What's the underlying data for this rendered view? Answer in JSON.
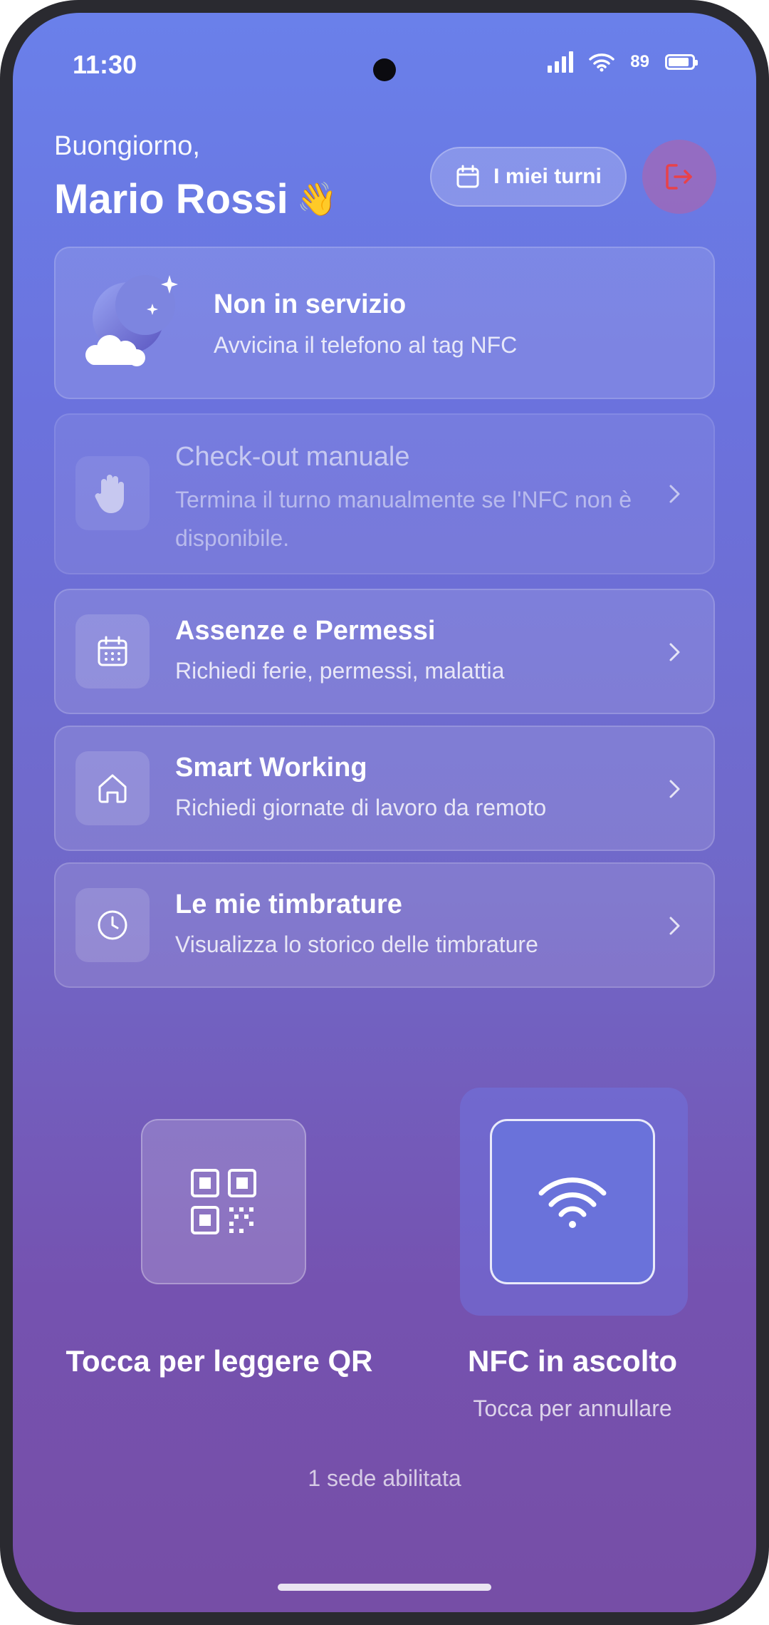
{
  "status_bar": {
    "time": "11:30",
    "battery_percent": "89",
    "battery_level": 0.89,
    "icons": [
      "signal-icon",
      "wifi-icon",
      "battery-icon"
    ]
  },
  "header": {
    "greeting": "Buongiorno,",
    "user_name": "Mario Rossi",
    "wave_emoji": "👋",
    "shifts_button_label": "I miei turni",
    "logout_icon": "logout-icon"
  },
  "status_card": {
    "title": "Non in servizio",
    "subtitle": "Avvicina il telefono al tag NFC",
    "icon": "moon-icon"
  },
  "menu": [
    {
      "title": "Check-out manuale",
      "subtitle": "Termina il turno manualmente se l'NFC non è disponibile.",
      "icon": "hand-icon",
      "disabled": true
    },
    {
      "title": "Assenze e Permessi",
      "subtitle": "Richiedi ferie, permessi, malattia",
      "icon": "calendar-icon",
      "disabled": false
    },
    {
      "title": "Smart Working",
      "subtitle": "Richiedi giornate di lavoro da remoto",
      "icon": "home-icon",
      "disabled": false
    },
    {
      "title": "Le mie timbrature",
      "subtitle": "Visualizza lo storico delle timbrature",
      "icon": "clock-icon",
      "disabled": false
    }
  ],
  "actions": {
    "qr_label": "Tocca per leggere QR",
    "nfc_label": "NFC in ascolto",
    "nfc_sublabel": "Tocca per annullare"
  },
  "footer": {
    "sites_text": "1 sede abilitata"
  },
  "colors": {
    "gradient_top": "#6a80ea",
    "gradient_bottom": "#764ea6",
    "logout_red": "#e8424a",
    "nfc_active": "#6a72da"
  }
}
